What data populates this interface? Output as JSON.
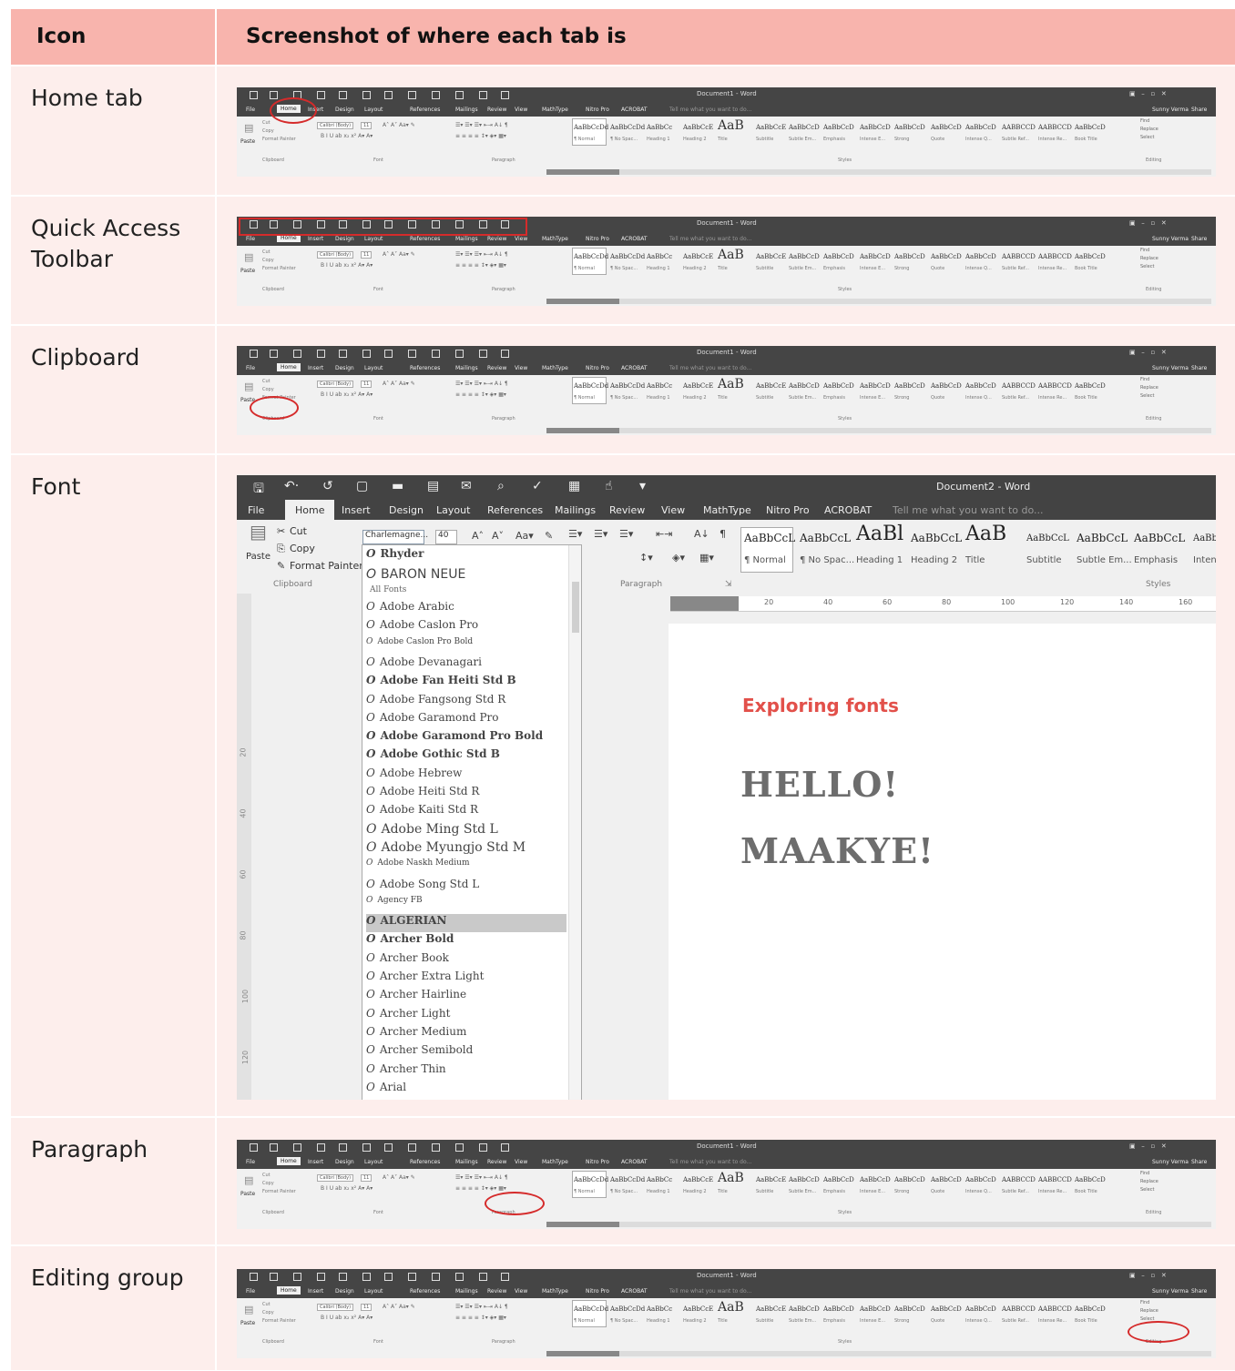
{
  "header": {
    "col_icon": "Icon",
    "col_screenshot": "Screenshot of where each tab is"
  },
  "rows": [
    {
      "label": "Home tab",
      "highlight": "Home tab"
    },
    {
      "label": "Quick Access Toolbar",
      "highlight": "Quick Access Toolbar"
    },
    {
      "label": "Clipboard",
      "highlight": "Clipboard group"
    },
    {
      "label": "Font",
      "highlight": "Font dropdown"
    },
    {
      "label": "Paragraph",
      "highlight": "Paragraph group"
    },
    {
      "label": "Editing group",
      "highlight": "Editing group"
    }
  ],
  "colors": {
    "header": "#f8b4ad",
    "row": "#fdeeec",
    "highlight": "#d52b2b",
    "accent_text": "#e2504a"
  },
  "mini_ribbon": {
    "title": "Document1 - Word",
    "tabs": [
      "File",
      "Home",
      "Insert",
      "Design",
      "Layout",
      "References",
      "Mailings",
      "Review",
      "View",
      "MathType",
      "Nitro Pro",
      "ACROBAT"
    ],
    "tell_me": "Tell me what you want to do...",
    "user": "Sunny Verma",
    "share": "Share",
    "clipboard_items": [
      "Cut",
      "Copy",
      "Format Painter"
    ],
    "paste": "Paste",
    "font_name": "Calibri (Body)",
    "font_size": "11",
    "styles": [
      "AaBbCcDd",
      "AaBbCcDd",
      "AaBbCc",
      "AaBbCcE",
      "AaB",
      "AaBbCcE",
      "AaBbCcD",
      "AaBbCcD",
      "AaBbCcD",
      "AaBbCcD",
      "AaBbCcD",
      "AaBbCcD",
      "AABBCCD",
      "AABBCCD",
      "AaBbCcD"
    ],
    "style_labels": [
      "¶ Normal",
      "¶ No Spac...",
      "Heading 1",
      "Heading 2",
      "Title",
      "Subtitle",
      "Subtle Em...",
      "Emphasis",
      "Intense E...",
      "Strong",
      "Quote",
      "Intense Q...",
      "Subtle Ref...",
      "Intense Re...",
      "Book Title"
    ],
    "groups": {
      "clipboard": "Clipboard",
      "font": "Font",
      "paragraph": "Paragraph",
      "styles": "Styles",
      "editing": "Editing"
    },
    "editing_items": [
      "Find",
      "Replace",
      "Select"
    ]
  },
  "font_screenshot": {
    "title": "Document2 - Word",
    "tabs": [
      "File",
      "Home",
      "Insert",
      "Design",
      "Layout",
      "References",
      "Mailings",
      "Review",
      "View",
      "MathType",
      "Nitro Pro",
      "ACROBAT"
    ],
    "tell_me": "Tell me what you want to do...",
    "clipboard": {
      "cut": "Cut",
      "copy": "Copy",
      "format_painter": "Format Painter",
      "paste": "Paste",
      "group": "Clipboard"
    },
    "font_name": "Charlemagne...",
    "font_size": "40",
    "paragraph_group": "Paragraph",
    "styles_group": "Styles",
    "styles": [
      {
        "sample": "AaBbCcL",
        "label": "¶ Normal"
      },
      {
        "sample": "AaBbCcL",
        "label": "¶ No Spac..."
      },
      {
        "sample": "AaBl",
        "label": "Heading 1"
      },
      {
        "sample": "AaBbCcL",
        "label": "Heading 2"
      },
      {
        "sample": "AaB",
        "label": "Title"
      },
      {
        "sample": "AaBbCcL",
        "label": "Subtitle"
      },
      {
        "sample": "AaBbCcL",
        "label": "Subtle Em..."
      },
      {
        "sample": "AaBbCcL",
        "label": "Emphasis"
      },
      {
        "sample": "AaBb",
        "label": "Intens"
      }
    ],
    "ruler_ticks": [
      "20",
      "40",
      "60",
      "80",
      "100",
      "120",
      "140",
      "160"
    ],
    "vruler_ticks": [
      "20",
      "40",
      "60",
      "80",
      "100",
      "120"
    ],
    "recent_fonts": [
      "Rhyder",
      "BARON NEUE"
    ],
    "all_fonts_label": "All Fonts",
    "fonts": [
      "Adobe Arabic",
      "Adobe Caslon Pro",
      "Adobe Caslon Pro Bold",
      "Adobe Devanagari",
      "Adobe Fan Heiti Std B",
      "Adobe Fangsong Std R",
      "Adobe Garamond Pro",
      "Adobe Garamond Pro Bold",
      "Adobe Gothic Std B",
      "Adobe Hebrew",
      "Adobe Heiti Std R",
      "Adobe Kaiti Std R",
      "Adobe Ming Std L",
      "Adobe Myungjo Std M",
      "Adobe Naskh Medium",
      "Adobe Song Std L",
      "Agency FB",
      "ALGERIAN",
      "Archer Bold",
      "Archer Book",
      "Archer Extra Light",
      "Archer Hairline",
      "Archer Light",
      "Archer Medium",
      "Archer Semibold",
      "Archer Thin",
      "Arial"
    ],
    "selected_font": "ALGERIAN",
    "doc_heading": "Exploring fonts",
    "doc_lines": [
      "HELLO!",
      "MAAKYE!"
    ]
  }
}
